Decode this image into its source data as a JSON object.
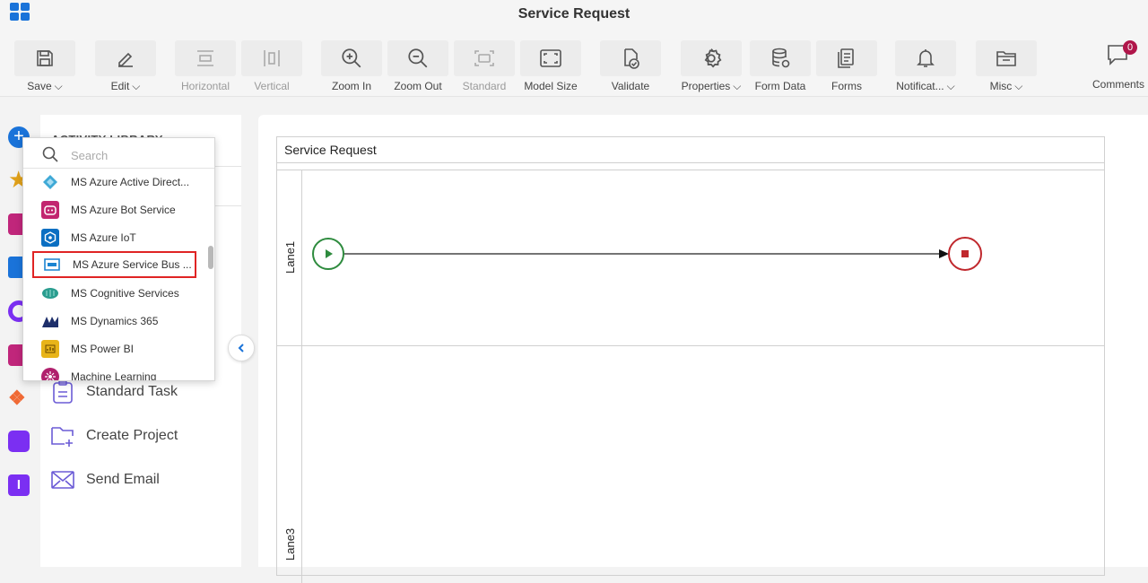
{
  "app": {
    "title": "Service Request"
  },
  "toolbar": {
    "items": [
      {
        "label": "Save",
        "icon": "save-icon",
        "dropdown": true,
        "disabled": false
      },
      {
        "label": "Edit",
        "icon": "pencil-icon",
        "dropdown": true,
        "disabled": false
      },
      {
        "label": "Horizontal",
        "icon": "horizontal-layout-icon",
        "dropdown": false,
        "disabled": true
      },
      {
        "label": "Vertical",
        "icon": "vertical-layout-icon",
        "dropdown": false,
        "disabled": true
      },
      {
        "label": "Zoom In",
        "icon": "zoom-in-icon",
        "dropdown": false,
        "disabled": false
      },
      {
        "label": "Zoom Out",
        "icon": "zoom-out-icon",
        "dropdown": false,
        "disabled": false
      },
      {
        "label": "Standard",
        "icon": "standard-size-icon",
        "dropdown": false,
        "disabled": true
      },
      {
        "label": "Model Size",
        "icon": "model-size-icon",
        "dropdown": false,
        "disabled": false
      },
      {
        "label": "Validate",
        "icon": "validate-icon",
        "dropdown": false,
        "disabled": false
      },
      {
        "label": "Properties",
        "icon": "gear-icon",
        "dropdown": true,
        "disabled": false
      },
      {
        "label": "Form Data",
        "icon": "database-icon",
        "dropdown": false,
        "disabled": false
      },
      {
        "label": "Forms",
        "icon": "forms-icon",
        "dropdown": false,
        "disabled": false
      },
      {
        "label": "Notificat...",
        "icon": "bell-icon",
        "dropdown": true,
        "disabled": false
      },
      {
        "label": "Misc",
        "icon": "folder-icon",
        "dropdown": true,
        "disabled": false
      }
    ],
    "comments": {
      "label": "Comments",
      "count": "0"
    }
  },
  "library": {
    "title": "ACTIVITY LIBRARY",
    "tasks": [
      {
        "label": "Standard Task",
        "icon": "standard-task-icon"
      },
      {
        "label": "Create Project",
        "icon": "create-project-icon"
      },
      {
        "label": "Send Email",
        "icon": "send-email-icon"
      }
    ]
  },
  "dropdown": {
    "search_placeholder": "Search",
    "items": [
      {
        "label": "MS Azure Active Direct...",
        "icon": "azure-ad-icon",
        "color": "#3fa9d6"
      },
      {
        "label": "MS Azure Bot Service",
        "icon": "bot-service-icon",
        "color": "#c2266f"
      },
      {
        "label": "MS Azure IoT",
        "icon": "azure-iot-icon",
        "color": "#0b6fc2"
      },
      {
        "label": "MS Azure Service Bus ...",
        "icon": "service-bus-icon",
        "color": "#1b84d1",
        "selected": true
      },
      {
        "label": "MS Cognitive Services",
        "icon": "cognitive-services-icon",
        "color": "#2a9d8f"
      },
      {
        "label": "MS Dynamics 365",
        "icon": "dynamics-365-icon",
        "color": "#1e2f6b"
      },
      {
        "label": "MS Power BI",
        "icon": "power-bi-icon",
        "color": "#e8b419"
      },
      {
        "label": "Machine Learning",
        "icon": "machine-learning-icon",
        "color": "#b0206d"
      }
    ]
  },
  "canvas": {
    "pool_title": "Service Request",
    "lanes": [
      "Lane1",
      "Lane3"
    ]
  },
  "colors": {
    "accent": "#1a73d9",
    "start_event": "#2e8b3e",
    "end_event": "#c0282d",
    "selection": "#e02424"
  }
}
